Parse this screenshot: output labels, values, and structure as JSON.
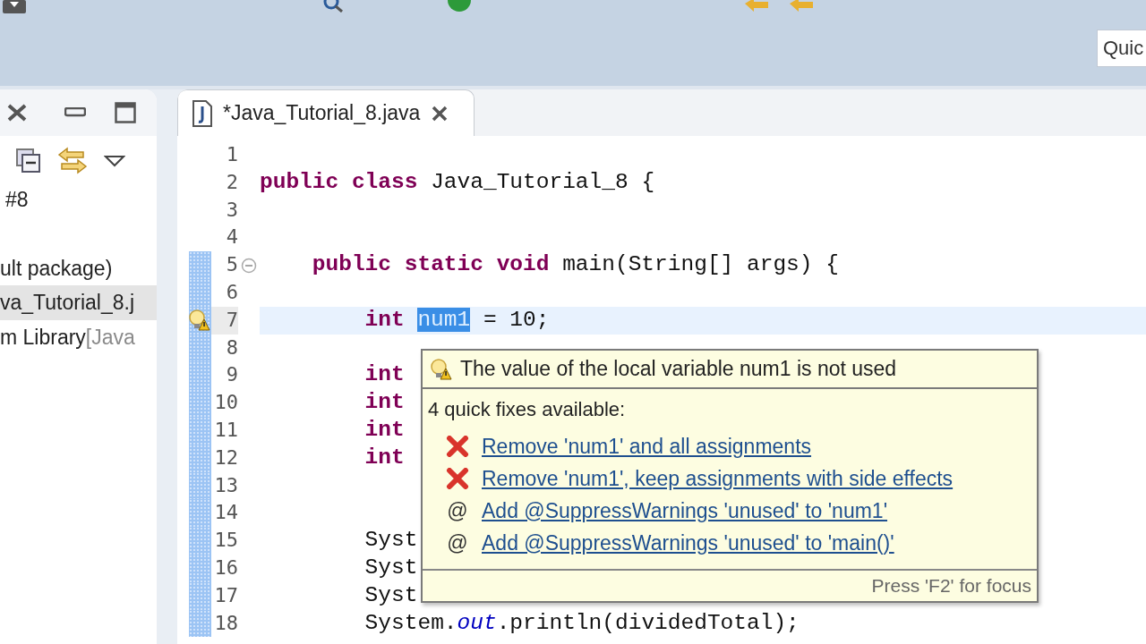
{
  "toolbar": {
    "quick_access": {
      "placeholder": "Quic"
    }
  },
  "left_panel": {
    "tree": [
      {
        "label": "#8",
        "selected": false
      },
      {
        "label": "ult package)",
        "selected": false
      },
      {
        "label": "va_Tutorial_8.j",
        "selected": true
      },
      {
        "label": "m Library",
        "suffix": "[Java",
        "selected": false
      }
    ]
  },
  "editor": {
    "tab": {
      "title": "*Java_Tutorial_8.java",
      "selected": true
    },
    "lines": [
      {
        "number": "1",
        "changed": false
      },
      {
        "number": "2",
        "changed": false,
        "segments": [
          {
            "kind": "keyword",
            "text": "public class"
          },
          {
            "kind": "plain",
            "text": " Java_Tutorial_8 {"
          }
        ]
      },
      {
        "number": "3",
        "changed": false
      },
      {
        "number": "4",
        "changed": false
      },
      {
        "number": "5",
        "changed": true,
        "collapsible": true,
        "segments": [
          {
            "kind": "keyword",
            "text": "    public static void"
          },
          {
            "kind": "plain",
            "text": " main(String[] args) {"
          }
        ]
      },
      {
        "number": "6",
        "changed": true
      },
      {
        "number": "7",
        "changed": true,
        "current": true,
        "warning": true,
        "segments": [
          {
            "kind": "keyword",
            "text": "        int"
          },
          {
            "kind": "selection",
            "text": "num1"
          },
          {
            "kind": "plain",
            "text": " = 10;"
          }
        ]
      },
      {
        "number": "8",
        "changed": true
      },
      {
        "number": "9",
        "changed": true,
        "segments": [
          {
            "kind": "keyword",
            "text": "        int"
          }
        ]
      },
      {
        "number": "10",
        "changed": true,
        "segments": [
          {
            "kind": "keyword",
            "text": "        int"
          }
        ]
      },
      {
        "number": "11",
        "changed": true,
        "segments": [
          {
            "kind": "keyword",
            "text": "        int"
          }
        ]
      },
      {
        "number": "12",
        "changed": true,
        "segments": [
          {
            "kind": "keyword",
            "text": "        int"
          }
        ]
      },
      {
        "number": "13",
        "changed": true
      },
      {
        "number": "14",
        "changed": true
      },
      {
        "number": "15",
        "changed": true,
        "segments": [
          {
            "kind": "plain",
            "text": "        Syst"
          }
        ]
      },
      {
        "number": "16",
        "changed": true,
        "segments": [
          {
            "kind": "plain",
            "text": "        Syst"
          }
        ]
      },
      {
        "number": "17",
        "changed": true,
        "segments": [
          {
            "kind": "plain",
            "text": "        Syst"
          }
        ]
      },
      {
        "number": "18",
        "changed": true,
        "segments": [
          {
            "kind": "plain",
            "text": "        System."
          },
          {
            "kind": "field",
            "text": "out"
          },
          {
            "kind": "plain",
            "text": ".println(dividedTotal);"
          }
        ]
      }
    ],
    "quick_fix_popup": {
      "message": "The value of the local variable num1 is not used",
      "subtitle": "4 quick fixes available:",
      "fixes": [
        {
          "kind": "remove",
          "label": "Remove 'num1' and all assignments"
        },
        {
          "kind": "remove",
          "label": "Remove 'num1', keep assignments with side effects"
        },
        {
          "kind": "annotation",
          "symbol": "@",
          "label": "Add @SuppressWarnings 'unused' to 'num1'"
        },
        {
          "kind": "annotation",
          "symbol": "@",
          "label": "Add @SuppressWarnings 'unused' to 'main()'"
        }
      ],
      "footer": "Press 'F2' for focus"
    }
  }
}
